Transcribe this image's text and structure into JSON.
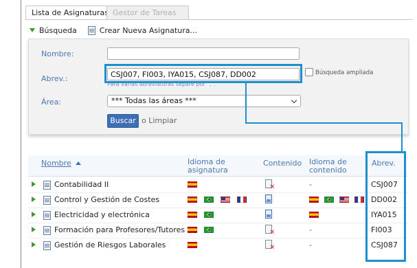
{
  "tabs": [
    {
      "label": "Lista de Asignaturas",
      "active": true
    },
    {
      "label": "Gestor de Tareas",
      "active": false
    }
  ],
  "toolbar": {
    "search_label": "Búsqueda",
    "create_label": "Crear Nueva Asignatura..."
  },
  "search_form": {
    "name_label": "Nombre:",
    "name_value": "",
    "abbr_label": "Abrev.:",
    "abbr_value": "CSJ007, FI003, IYA015, CSJ087, DD002",
    "abbr_hint": "Para varias abreviaturas separe por \",\".",
    "extended_label": "Búsqueda ampliada",
    "area_label": "Área:",
    "area_value": "*** Todas las áreas ***",
    "search_button": "Buscar",
    "or_clear": "o Limpiar"
  },
  "table": {
    "headers": {
      "name": "Nombre",
      "lang_subject_1": "Idioma de",
      "lang_subject_2": "asignatura",
      "content": "Contenido",
      "lang_content_1": "Idioma de",
      "lang_content_2": "contenido",
      "abbr": "Abrev."
    },
    "rows": [
      {
        "name": "Contabilidad II",
        "subject_flags": [
          "es"
        ],
        "content": "missing",
        "content_lang": "-",
        "content_flags": [],
        "abbr": "CSJ007"
      },
      {
        "name": "Control y Gestión de Costes",
        "subject_flags": [
          "es",
          "br",
          "us",
          "fr"
        ],
        "content": "present",
        "content_lang": "",
        "content_flags": [
          "es",
          "br",
          "us",
          "fr"
        ],
        "abbr": "DD002"
      },
      {
        "name": "Electricidad y electrónica",
        "subject_flags": [
          "es",
          "br"
        ],
        "content": "present",
        "content_lang": "",
        "content_flags": [
          "es"
        ],
        "abbr": "IYA015"
      },
      {
        "name": "Formación para Profesores/Tutores",
        "subject_flags": [
          "es",
          "br"
        ],
        "content": "missing",
        "content_lang": "-",
        "content_flags": [],
        "abbr": "FI003"
      },
      {
        "name": "Gestión de Riesgos Laborales",
        "subject_flags": [
          "es"
        ],
        "content": "missing",
        "content_lang": "-",
        "content_flags": [],
        "abbr": "CSJ087"
      }
    ]
  },
  "colors": {
    "accent": "#3d6fb6",
    "highlight": "#1a90cf",
    "label": "#4a76b3"
  }
}
